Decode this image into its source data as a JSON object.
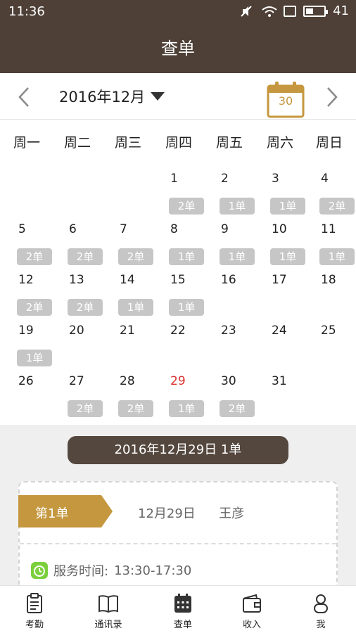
{
  "status": {
    "time": "11:36",
    "battery": "41",
    "battery_level": 0.41
  },
  "header": {
    "title": "查单"
  },
  "month_nav": {
    "label": "2016年12月",
    "calendar_icon_day": "30"
  },
  "weekdays": [
    "周一",
    "周二",
    "周三",
    "周四",
    "周五",
    "周六",
    "周日"
  ],
  "days": [
    {
      "day": "1",
      "orders": "2单"
    },
    {
      "day": "2",
      "orders": "1单"
    },
    {
      "day": "3",
      "orders": "1单"
    },
    {
      "day": "4",
      "orders": "2单"
    },
    {
      "day": "5",
      "orders": "2单"
    },
    {
      "day": "6",
      "orders": "2单"
    },
    {
      "day": "7",
      "orders": "2单"
    },
    {
      "day": "8",
      "orders": "1单"
    },
    {
      "day": "9",
      "orders": "1单"
    },
    {
      "day": "10",
      "orders": "1单"
    },
    {
      "day": "11",
      "orders": "1单"
    },
    {
      "day": "12",
      "orders": "2单"
    },
    {
      "day": "13",
      "orders": "2单"
    },
    {
      "day": "14",
      "orders": "1单"
    },
    {
      "day": "15",
      "orders": "1单"
    },
    {
      "day": "16",
      "orders": ""
    },
    {
      "day": "17",
      "orders": ""
    },
    {
      "day": "18",
      "orders": ""
    },
    {
      "day": "19",
      "orders": "1单"
    },
    {
      "day": "20",
      "orders": ""
    },
    {
      "day": "21",
      "orders": ""
    },
    {
      "day": "22",
      "orders": ""
    },
    {
      "day": "23",
      "orders": ""
    },
    {
      "day": "24",
      "orders": ""
    },
    {
      "day": "25",
      "orders": ""
    },
    {
      "day": "26",
      "orders": ""
    },
    {
      "day": "27",
      "orders": "2单"
    },
    {
      "day": "28",
      "orders": "2单"
    },
    {
      "day": "29",
      "orders": "1单",
      "today": true
    },
    {
      "day": "30",
      "orders": "2单"
    },
    {
      "day": "31",
      "orders": ""
    }
  ],
  "selected": {
    "label": "2016年12月29日   1单"
  },
  "order_card": {
    "ribbon": "第1单",
    "date": "12月29日",
    "name": "王彦",
    "service_label": "服务时间:",
    "service_time": "13:30-17:30"
  },
  "tabs": [
    {
      "label": "考勤",
      "icon": "clipboard-icon"
    },
    {
      "label": "通讯录",
      "icon": "book-icon"
    },
    {
      "label": "查单",
      "icon": "calendar-grid-icon"
    },
    {
      "label": "收入",
      "icon": "wallet-icon"
    },
    {
      "label": "我",
      "icon": "person-icon"
    }
  ],
  "colors": {
    "brand": "#4e4037",
    "gold": "#c5973e",
    "badge": "#c6c6c6",
    "today": "#d9302c",
    "green": "#7bcf3c"
  }
}
